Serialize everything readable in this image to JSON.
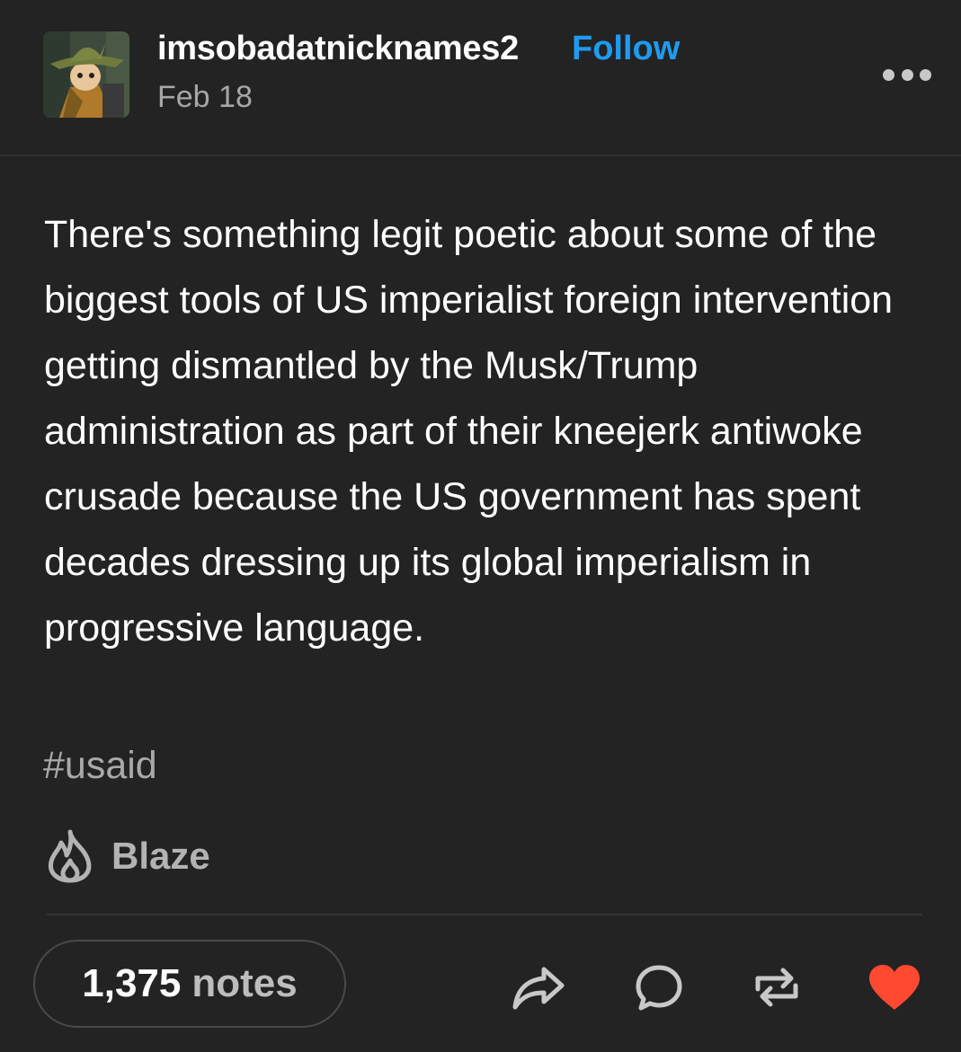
{
  "post": {
    "username": "imsobadatnicknames2",
    "follow_label": "Follow",
    "date": "Feb 18",
    "body": "There's something legit poetic about some of the biggest tools of US imperialist foreign intervention getting dismantled by the Musk/Trump administration as part of their kneejerk antiwoke crusade because the US government has spent decades dressing up its global imperialism in progressive language.",
    "tag": "#usaid",
    "blaze_label": "Blaze",
    "notes_count": "1,375",
    "notes_label": "notes"
  },
  "icons": {
    "more": "more-options-icon",
    "blaze": "flame-icon",
    "share": "share-icon",
    "reply": "reply-bubble-icon",
    "reblog": "reblog-icon",
    "like": "heart-icon"
  },
  "colors": {
    "background": "#232323",
    "follow": "#1e9bf0",
    "like": "#ff4930",
    "muted_text": "#a7a7a7"
  }
}
